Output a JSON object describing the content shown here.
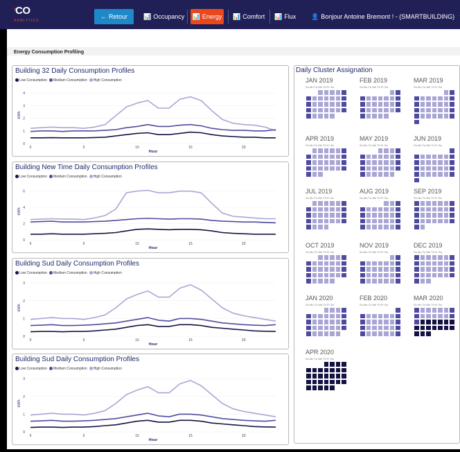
{
  "navbar": {
    "logo_text": "CO",
    "logo_sub": "ANALYTICS",
    "retour_label": "Retour",
    "occupancy_label": "Occupancy",
    "energy_label": "Energy",
    "comfort_label": "Comfort",
    "flux_label": "Flux",
    "user_label": "Bonjour Antoine Bremont ! - (SMARTBUILDING)",
    "colors": {
      "bg": "#202057",
      "retour": "#1f88c9",
      "energy_active": "#e8481c"
    }
  },
  "page": {
    "title": "Energy Consumption Profiling"
  },
  "legend": {
    "low": "Low Consumption",
    "medium": "Medium Consumption",
    "high": "High Consumption"
  },
  "series_colors": {
    "low": "#141242",
    "medium": "#4e4b9f",
    "high": "#a9a6d4"
  },
  "charts": [
    {
      "title": "Building 32 Daily Consumption Profiles",
      "xlabel": "Hour",
      "ylabel": "kWh",
      "yticks": [
        "0",
        "1",
        "2",
        "3",
        "4"
      ],
      "xticks": [
        "0",
        "5",
        "10",
        "15",
        "20"
      ],
      "chart_data": {
        "type": "line",
        "x": [
          0,
          1,
          2,
          3,
          4,
          5,
          6,
          7,
          8,
          9,
          10,
          11,
          12,
          13,
          14,
          15,
          16,
          17,
          18,
          19,
          20,
          21,
          22,
          23
        ],
        "ylim": [
          0,
          4.5
        ],
        "xlim": [
          0,
          23
        ],
        "series": [
          {
            "name": "Low Consumption",
            "values": [
              0.45,
              0.45,
              0.46,
              0.45,
              0.45,
              0.45,
              0.47,
              0.5,
              0.6,
              0.7,
              0.8,
              0.85,
              0.7,
              0.7,
              0.8,
              0.9,
              0.85,
              0.7,
              0.6,
              0.55,
              0.5,
              0.5,
              0.45,
              0.45
            ]
          },
          {
            "name": "Medium Consumption",
            "values": [
              0.95,
              1.0,
              1.0,
              0.95,
              1.0,
              1.0,
              1.0,
              1.05,
              1.1,
              1.25,
              1.35,
              1.5,
              1.35,
              1.35,
              1.45,
              1.5,
              1.4,
              1.2,
              1.1,
              1.05,
              1.05,
              1.0,
              1.0,
              1.1
            ]
          },
          {
            "name": "High Consumption",
            "values": [
              1.2,
              1.25,
              1.3,
              1.25,
              1.25,
              1.2,
              1.3,
              1.5,
              2.2,
              2.9,
              3.2,
              3.4,
              2.8,
              2.8,
              3.5,
              3.7,
              3.4,
              2.6,
              1.9,
              1.6,
              1.5,
              1.45,
              1.3,
              1.0
            ]
          }
        ]
      }
    },
    {
      "title": "Building New Time Daily Consumption Profiles",
      "xlabel": "Hour",
      "ylabel": "kWh",
      "yticks": [
        "0",
        "2",
        "4",
        "6"
      ],
      "xticks": [
        "0",
        "5",
        "10",
        "15",
        "20"
      ],
      "chart_data": {
        "type": "line",
        "x": [
          0,
          1,
          2,
          3,
          4,
          5,
          6,
          7,
          8,
          9,
          10,
          11,
          12,
          13,
          14,
          15,
          16,
          17,
          18,
          19,
          20,
          21,
          22,
          23
        ],
        "ylim": [
          0,
          7
        ],
        "xlim": [
          0,
          23
        ],
        "series": [
          {
            "name": "Low Consumption",
            "values": [
              0.7,
              0.7,
              0.75,
              0.7,
              0.7,
              0.7,
              0.75,
              0.8,
              0.9,
              1.1,
              1.3,
              1.35,
              1.3,
              1.25,
              1.3,
              1.3,
              1.25,
              1.1,
              0.9,
              0.8,
              0.75,
              0.7,
              0.7,
              0.7
            ]
          },
          {
            "name": "Medium Consumption",
            "values": [
              2.2,
              2.25,
              2.3,
              2.2,
              2.2,
              2.2,
              2.25,
              2.3,
              2.4,
              2.5,
              2.6,
              2.65,
              2.6,
              2.55,
              2.6,
              2.6,
              2.55,
              2.4,
              2.3,
              2.25,
              2.2,
              2.2,
              2.15,
              2.1
            ]
          },
          {
            "name": "High Consumption",
            "values": [
              2.5,
              2.55,
              2.6,
              2.55,
              2.55,
              2.5,
              2.7,
              3.0,
              3.8,
              5.8,
              6.0,
              6.1,
              5.8,
              5.8,
              6.0,
              6.0,
              5.8,
              4.5,
              3.3,
              2.9,
              2.8,
              2.7,
              2.6,
              2.6
            ]
          }
        ]
      }
    },
    {
      "title": "Building Sud Daily Consumption Profiles",
      "xlabel": "Hour",
      "ylabel": "kWh",
      "yticks": [
        "0",
        "1",
        "2",
        "3"
      ],
      "xticks": [
        "0",
        "5",
        "10",
        "15",
        "20"
      ],
      "chart_data": {
        "type": "line",
        "x": [
          0,
          1,
          2,
          3,
          4,
          5,
          6,
          7,
          8,
          9,
          10,
          11,
          12,
          13,
          14,
          15,
          16,
          17,
          18,
          19,
          20,
          21,
          22,
          23
        ],
        "ylim": [
          0,
          3.2
        ],
        "xlim": [
          0,
          23
        ],
        "series": [
          {
            "name": "Low Consumption",
            "values": [
              0.25,
              0.27,
              0.27,
              0.25,
              0.27,
              0.27,
              0.3,
              0.35,
              0.4,
              0.5,
              0.6,
              0.65,
              0.55,
              0.55,
              0.65,
              0.65,
              0.6,
              0.5,
              0.45,
              0.4,
              0.35,
              0.3,
              0.28,
              0.27
            ]
          },
          {
            "name": "Medium Consumption",
            "values": [
              0.6,
              0.62,
              0.65,
              0.6,
              0.6,
              0.62,
              0.65,
              0.7,
              0.75,
              0.85,
              0.95,
              1.05,
              0.9,
              0.85,
              1.0,
              1.0,
              0.95,
              0.85,
              0.75,
              0.7,
              0.65,
              0.62,
              0.6,
              0.65
            ]
          },
          {
            "name": "High Consumption",
            "values": [
              0.95,
              1.0,
              1.05,
              1.0,
              1.0,
              0.95,
              1.05,
              1.2,
              1.6,
              2.1,
              2.35,
              2.55,
              2.2,
              2.2,
              2.7,
              2.9,
              2.6,
              2.1,
              1.6,
              1.3,
              1.15,
              1.05,
              0.95,
              0.85
            ]
          }
        ]
      }
    },
    {
      "title": "Building Sud Daily Consumption Profiles",
      "xlabel": "Hour",
      "ylabel": "kWh",
      "yticks": [
        "0",
        "1",
        "2",
        "3"
      ],
      "xticks": [
        "0",
        "5",
        "10",
        "15",
        "20"
      ],
      "chart_data": {
        "type": "line",
        "x": [
          0,
          1,
          2,
          3,
          4,
          5,
          6,
          7,
          8,
          9,
          10,
          11,
          12,
          13,
          14,
          15,
          16,
          17,
          18,
          19,
          20,
          21,
          22,
          23
        ],
        "ylim": [
          0,
          3.2
        ],
        "xlim": [
          0,
          23
        ],
        "series": [
          {
            "name": "Low Consumption",
            "values": [
              0.25,
              0.27,
              0.27,
              0.25,
              0.27,
              0.27,
              0.3,
              0.35,
              0.4,
              0.5,
              0.6,
              0.65,
              0.55,
              0.55,
              0.65,
              0.65,
              0.6,
              0.5,
              0.45,
              0.4,
              0.35,
              0.3,
              0.28,
              0.27
            ]
          },
          {
            "name": "Medium Consumption",
            "values": [
              0.6,
              0.62,
              0.65,
              0.6,
              0.6,
              0.62,
              0.65,
              0.7,
              0.75,
              0.85,
              0.95,
              1.05,
              0.9,
              0.85,
              1.0,
              1.0,
              0.95,
              0.85,
              0.75,
              0.7,
              0.65,
              0.62,
              0.6,
              0.65
            ]
          },
          {
            "name": "High Consumption",
            "values": [
              0.95,
              1.0,
              1.05,
              1.0,
              1.0,
              0.95,
              1.05,
              1.2,
              1.6,
              2.1,
              2.35,
              2.55,
              2.2,
              2.2,
              2.7,
              2.9,
              2.6,
              2.1,
              1.6,
              1.3,
              1.15,
              1.05,
              0.95,
              0.85
            ]
          }
        ]
      }
    }
  ],
  "calendar": {
    "title": "Daily Cluster Assignation",
    "weekdays": "Su Mo Tu We Th Fr Sa",
    "months": [
      {
        "name": "JAN 2019",
        "start": 2,
        "days": 31,
        "pattern": "weekday-high"
      },
      {
        "name": "FEB 2019",
        "start": 5,
        "days": 28,
        "pattern": "weekday-high"
      },
      {
        "name": "MAR 2019",
        "start": 5,
        "days": 31,
        "pattern": "weekday-high"
      },
      {
        "name": "APR 2019",
        "start": 1,
        "days": 30,
        "pattern": "weekday-high"
      },
      {
        "name": "MAY 2019",
        "start": 3,
        "days": 31,
        "pattern": "weekday-high"
      },
      {
        "name": "JUN 2019",
        "start": 6,
        "days": 30,
        "pattern": "weekday-high"
      },
      {
        "name": "JUL 2019",
        "start": 1,
        "days": 31,
        "pattern": "weekday-high"
      },
      {
        "name": "AUG 2019",
        "start": 4,
        "days": 31,
        "pattern": "weekday-high"
      },
      {
        "name": "SEP 2019",
        "start": 0,
        "days": 30,
        "pattern": "weekday-high"
      },
      {
        "name": "OCT 2019",
        "start": 2,
        "days": 31,
        "pattern": "weekday-high"
      },
      {
        "name": "NOV 2019",
        "start": 5,
        "days": 30,
        "pattern": "weekday-high"
      },
      {
        "name": "DEC 2019",
        "start": 0,
        "days": 31,
        "pattern": "weekday-high"
      },
      {
        "name": "JAN 2020",
        "start": 3,
        "days": 31,
        "pattern": "weekday-high"
      },
      {
        "name": "FEB 2020",
        "start": 6,
        "days": 29,
        "pattern": "weekday-high"
      },
      {
        "name": "MAR 2020",
        "start": 0,
        "days": 31,
        "pattern": "mar2020"
      },
      {
        "name": "APR 2020",
        "start": 3,
        "days": 30,
        "pattern": "all-low"
      }
    ]
  }
}
